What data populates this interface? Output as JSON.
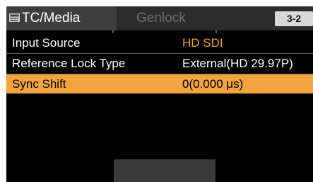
{
  "tabs": {
    "active": {
      "label": "TC/Media",
      "icon": "tc-media-icon"
    },
    "inactive": {
      "label": "Genlock"
    },
    "page": "3-2"
  },
  "menu": {
    "rows": [
      {
        "label": "Input Source",
        "value": "HD SDI"
      },
      {
        "label": "Reference Lock Type",
        "value": "External(HD 29.97P)"
      },
      {
        "label": "Sync Shift",
        "value": "0(0.000 μs)"
      }
    ]
  },
  "colors": {
    "accent": "#f2a43e",
    "background": "#000000",
    "tab_active": "#3e3e3e",
    "tab_bar": "#2c2c2c"
  }
}
